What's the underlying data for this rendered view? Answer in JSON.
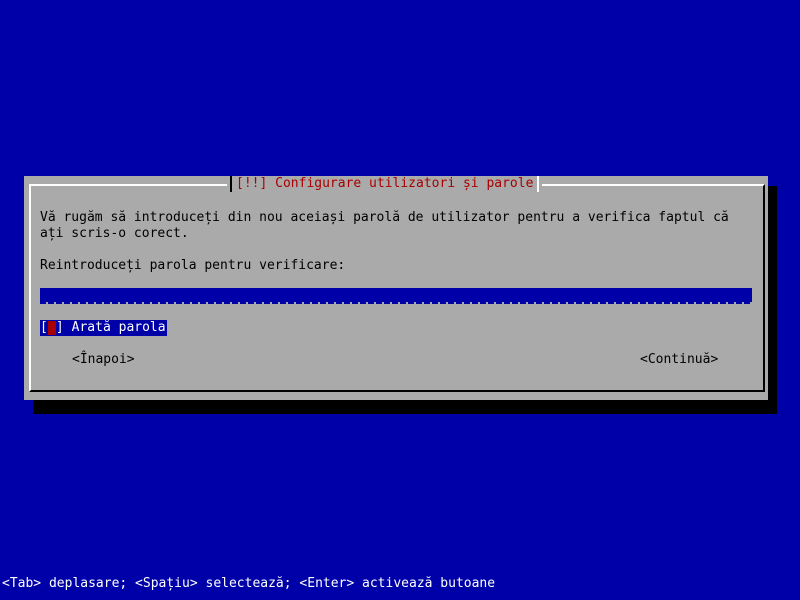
{
  "dialog": {
    "title": "[!!] Configurare utilizatori și parole",
    "message": "Vă rugăm să introduceți din nou aceiași parolă de utilizator pentru a verifica faptul că ați scris-o corect.",
    "prompt": "Reintroduceți parola pentru verificare:",
    "password_value": "",
    "show_password": {
      "open_bracket": "[",
      "close_bracket": "]",
      "label": "Arată parola",
      "checked": false
    },
    "buttons": {
      "back": "<Înapoi>",
      "continue": "<Continuă>"
    }
  },
  "status_bar": {
    "text": "<Tab> deplasare; <Spațiu> selectează; <Enter> activează butoane"
  },
  "colors": {
    "background": "#0000a8",
    "dialog": "#aaaaaa",
    "title": "#a80000",
    "shadow": "#000000",
    "focus": "#0000a8",
    "cursor": "#a80000"
  }
}
